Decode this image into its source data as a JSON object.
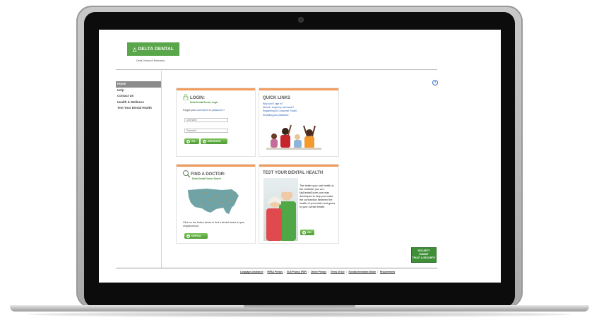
{
  "logo": {
    "text": "DELTA DENTAL",
    "icon": "delta-triangle-icon",
    "color": "#5aa64a"
  },
  "site_subtitle": "Delta Dental of Nebraska",
  "nav": {
    "items": [
      "Home",
      "Help",
      "Contact Us",
      "Health & Wellness",
      "Test Your Dental Health"
    ]
  },
  "login": {
    "title": "LOGIN:",
    "subtitle": "Delta Dental Secure Login",
    "forgot_prefix": "Forgot your",
    "forgot_username": "username",
    "forgot_or": "or",
    "forgot_password": "password",
    "forgot_suffix": "?",
    "username_placeholder": "Username",
    "password_placeholder": "Password",
    "go_label": "GO",
    "register_label": "REGISTER"
  },
  "quick_links": {
    "title": "QUICK LINKS",
    "items": [
      "Why can't I sign in?",
      "What if I forgot my username?",
      "Registering for Consumer Toolkit",
      "Resetting your password"
    ]
  },
  "find_doctor": {
    "title": "FIND A DOCTOR:",
    "subtitle": "Delta Dental Doctor Search",
    "text": "Click on the button below to find a dental doctor in your neighborhood.",
    "button_label": "DENTAL"
  },
  "test_health": {
    "title": "TEST YOUR DENTAL HEALTH",
    "text": "The better your oral health is, the healthier you are. MyDentalScore.com was developed to help you make the connection between the health of your teeth and gums to your overall health.",
    "button_label": "GO"
  },
  "badge": {
    "line1": "SECURITY",
    "line2": "SUMMIT",
    "line3": "TRUST & SECURITY"
  },
  "footer_links": [
    "Language Assistance",
    "HIPAA Privacy",
    "GLB Privacy (PDF)",
    "Online Privacy",
    "Terms of Use",
    "Nondiscrimination Notice",
    "Requirements"
  ],
  "colors": {
    "accent_orange": "#f39b5c",
    "brand_green": "#5aa64a",
    "link_blue": "#2a5db0"
  }
}
